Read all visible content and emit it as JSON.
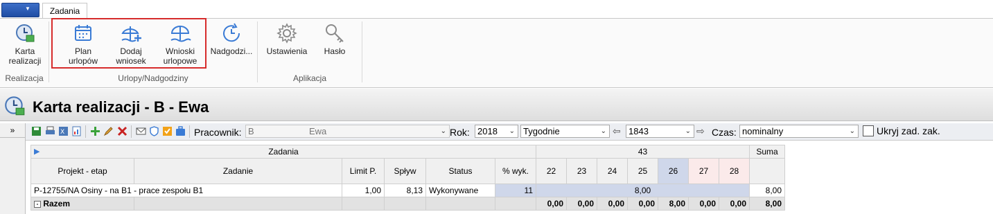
{
  "ribbon": {
    "tab": "Zadania",
    "groups": [
      {
        "label": "Realizacja"
      },
      {
        "label": "Urlopy/Nadgodziny"
      },
      {
        "label": "Aplikacja"
      }
    ],
    "buttons": {
      "karta_line1": "Karta",
      "karta_line2": "realizacji",
      "plan_line1": "Plan",
      "plan_line2": "urlopów",
      "dodaj_line1": "Dodaj",
      "dodaj_line2": "wniosek",
      "wnioski_line1": "Wnioski",
      "wnioski_line2": "urlopowe",
      "nadgodziny": "Nadgodzi...",
      "ustawienia": "Ustawienia",
      "haslo": "Hasło"
    }
  },
  "page": {
    "title": "Karta realizacji - B - Ewa"
  },
  "sidebar": {
    "collapse": "»"
  },
  "toolbar": {
    "pracownik_label": "Pracownik:",
    "pracownik_first": "B",
    "pracownik_last": "Ewa",
    "rok_label": "Rok:",
    "rok_value": "2018",
    "period_value": "Tygodnie",
    "week_value": "1843",
    "czas_label": "Czas:",
    "czas_value": "nominalny",
    "hide_label": "Ukryj zad. zak."
  },
  "grid": {
    "group_tasks": "Zadania",
    "group_week": "43",
    "sum_header": "Suma",
    "columns": {
      "projekt": "Projekt - etap",
      "zadanie": "Zadanie",
      "limit": "Limit P.",
      "splyw": "Spływ",
      "status": "Status",
      "wyk": "% wyk."
    },
    "days": [
      "22",
      "23",
      "24",
      "25",
      "26",
      "27",
      "28"
    ],
    "row": {
      "projekt": "P-12755/NA  Osiny - na B1 - prace zespołu B1",
      "limit": "1,00",
      "splyw": "8,13",
      "status": "Wykonywane",
      "wyk": "11",
      "week_total": "8,00",
      "sum": "8,00"
    },
    "total": {
      "label": "Razem",
      "days": [
        "0,00",
        "0,00",
        "0,00",
        "0,00",
        "8,00",
        "0,00",
        "0,00"
      ],
      "sum": "8,00"
    }
  },
  "colors": {
    "highlight": "#d62b2b",
    "accent": "#3a7bd5",
    "selected_day": "#cfd7ea",
    "weekend_day": "#fbeaea"
  }
}
